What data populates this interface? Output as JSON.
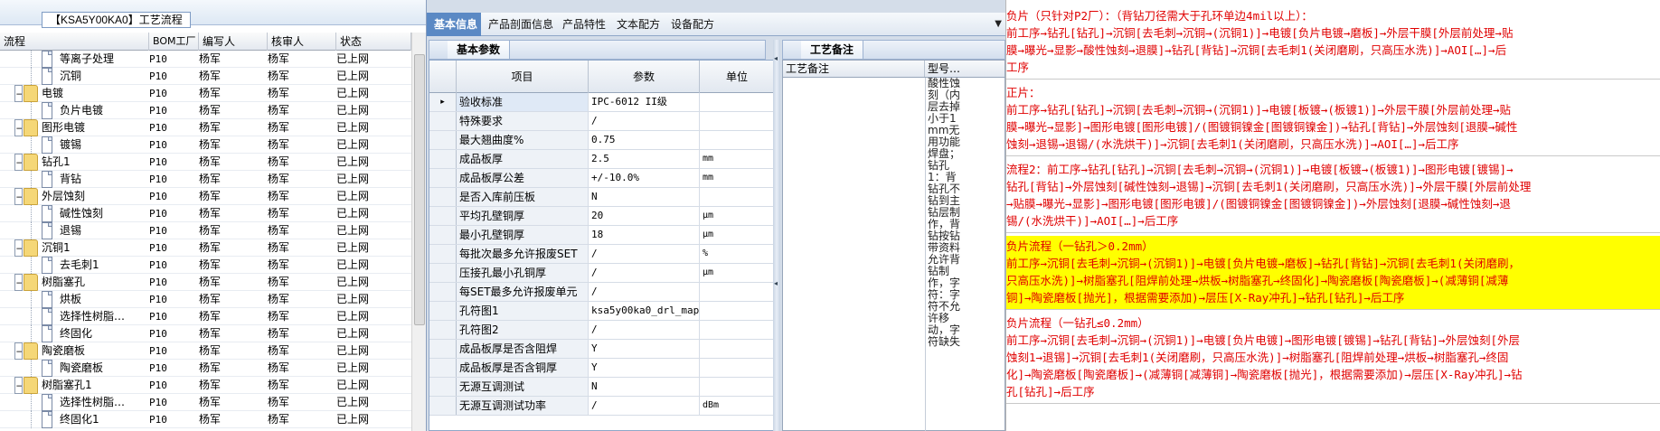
{
  "left_panel": {
    "title": "【KSA5Y00KA0】工艺流程",
    "columns": [
      "流程",
      "BOM工厂",
      "编写人",
      "核审人",
      "状态"
    ],
    "rows": [
      {
        "name": "等离子处理",
        "type": "doc",
        "level": 2,
        "bom": "P10",
        "writer": "杨军",
        "reviewer": "杨军",
        "status": "已上网"
      },
      {
        "name": "沉铜",
        "type": "doc",
        "level": 2,
        "bom": "P10",
        "writer": "杨军",
        "reviewer": "杨军",
        "status": "已上网"
      },
      {
        "name": "电镀",
        "type": "folder",
        "level": 1,
        "bom": "P10",
        "writer": "杨军",
        "reviewer": "杨军",
        "status": "已上网"
      },
      {
        "name": "负片电镀",
        "type": "doc",
        "level": 2,
        "bom": "P10",
        "writer": "杨军",
        "reviewer": "杨军",
        "status": "已上网"
      },
      {
        "name": "图形电镀",
        "type": "folder",
        "level": 1,
        "bom": "P10",
        "writer": "杨军",
        "reviewer": "杨军",
        "status": "已上网"
      },
      {
        "name": "镀锡",
        "type": "doc",
        "level": 2,
        "bom": "P10",
        "writer": "杨军",
        "reviewer": "杨军",
        "status": "已上网"
      },
      {
        "name": "钻孔1",
        "type": "folder",
        "level": 1,
        "bom": "P10",
        "writer": "杨军",
        "reviewer": "杨军",
        "status": "已上网"
      },
      {
        "name": "背钻",
        "type": "doc",
        "level": 2,
        "bom": "P10",
        "writer": "杨军",
        "reviewer": "杨军",
        "status": "已上网"
      },
      {
        "name": "外层蚀刻",
        "type": "folder",
        "level": 1,
        "bom": "P10",
        "writer": "杨军",
        "reviewer": "杨军",
        "status": "已上网"
      },
      {
        "name": "碱性蚀刻",
        "type": "doc",
        "level": 2,
        "bom": "P10",
        "writer": "杨军",
        "reviewer": "杨军",
        "status": "已上网"
      },
      {
        "name": "退锡",
        "type": "doc",
        "level": 2,
        "bom": "P10",
        "writer": "杨军",
        "reviewer": "杨军",
        "status": "已上网"
      },
      {
        "name": "沉铜1",
        "type": "folder",
        "level": 1,
        "bom": "P10",
        "writer": "杨军",
        "reviewer": "杨军",
        "status": "已上网"
      },
      {
        "name": "去毛刺1",
        "type": "doc",
        "level": 2,
        "bom": "P10",
        "writer": "杨军",
        "reviewer": "杨军",
        "status": "已上网"
      },
      {
        "name": "树脂塞孔",
        "type": "folder",
        "level": 1,
        "bom": "P10",
        "writer": "杨军",
        "reviewer": "杨军",
        "status": "已上网"
      },
      {
        "name": "烘板",
        "type": "doc",
        "level": 2,
        "bom": "P10",
        "writer": "杨军",
        "reviewer": "杨军",
        "status": "已上网"
      },
      {
        "name": "选择性树脂…",
        "type": "doc",
        "level": 2,
        "bom": "P10",
        "writer": "杨军",
        "reviewer": "杨军",
        "status": "已上网"
      },
      {
        "name": "终固化",
        "type": "doc",
        "level": 2,
        "bom": "P10",
        "writer": "杨军",
        "reviewer": "杨军",
        "status": "已上网"
      },
      {
        "name": "陶瓷磨板",
        "type": "folder",
        "level": 1,
        "bom": "P10",
        "writer": "杨军",
        "reviewer": "杨军",
        "status": "已上网"
      },
      {
        "name": "陶瓷磨板",
        "type": "doc",
        "level": 2,
        "bom": "P10",
        "writer": "杨军",
        "reviewer": "杨军",
        "status": "已上网"
      },
      {
        "name": "树脂塞孔1",
        "type": "folder",
        "level": 1,
        "bom": "P10",
        "writer": "杨军",
        "reviewer": "杨军",
        "status": "已上网"
      },
      {
        "name": "选择性树脂…",
        "type": "doc",
        "level": 2,
        "bom": "P10",
        "writer": "杨军",
        "reviewer": "杨军",
        "status": "已上网"
      },
      {
        "name": "终固化1",
        "type": "doc",
        "level": 2,
        "bom": "P10",
        "writer": "杨军",
        "reviewer": "杨军",
        "status": "已上网"
      }
    ]
  },
  "middle_panel": {
    "tabs": [
      "基本信息",
      "产品剖面信息",
      "产品特性",
      "文本配方",
      "设备配方"
    ],
    "sub_tab_left": "基本参数",
    "sub_tab_right": "工艺备注",
    "grid_headers": [
      "项目",
      "参数",
      "单位"
    ],
    "grid_rows": [
      {
        "name": "验收标准",
        "param": "IPC-6012 II级",
        "unit": "",
        "selected": true
      },
      {
        "name": "特殊要求",
        "param": "/",
        "unit": ""
      },
      {
        "name": "最大翘曲度%",
        "param": "0.75",
        "unit": ""
      },
      {
        "name": "成品板厚",
        "param": "2.5",
        "unit": "mm"
      },
      {
        "name": "成品板厚公差",
        "param": "+/-10.0%",
        "unit": "mm"
      },
      {
        "name": "是否入库前压板",
        "param": "N",
        "unit": ""
      },
      {
        "name": "平均孔壁铜厚",
        "param": "20",
        "unit": "μm"
      },
      {
        "name": "最小孔壁铜厚",
        "param": "18",
        "unit": "μm"
      },
      {
        "name": "每批次最多允许报废SET",
        "param": "/",
        "unit": "%"
      },
      {
        "name": "压接孔最小孔铜厚",
        "param": "/",
        "unit": "μm"
      },
      {
        "name": "每SET最多允许报废单元",
        "param": "/",
        "unit": ""
      },
      {
        "name": "孔符图1",
        "param": "ksa5y00ka0_drl_map.pdf",
        "unit": ""
      },
      {
        "name": "孔符图2",
        "param": "/",
        "unit": ""
      },
      {
        "name": "成品板厚是否含阻焊",
        "param": "Y",
        "unit": ""
      },
      {
        "name": "成品板厚是否含铜厚",
        "param": "Y",
        "unit": ""
      },
      {
        "name": "无源互调测试",
        "param": "N",
        "unit": ""
      },
      {
        "name": "无源互调测试功率",
        "param": "/",
        "unit": "dBm"
      }
    ],
    "notes_headers": [
      "工艺备注",
      "型号…"
    ],
    "notes_side_text": "酸性蚀刻（内层去掉小于1mm无用功能焊盘；钻孔1：背钻孔不钻到主钻层制作，背钻按钻带资料允许背钻制作，字符：字符不允许移动，字符缺失"
  },
  "right_panel": {
    "blocks": [
      {
        "highlight": false,
        "lines": [
          "负片（只针对P2厂）：（背钻刀径需大于孔环单边4mil以上）：",
          "前工序→钻孔[钻孔]→沉铜[去毛刺→沉铜→(沉铜1)]→电镀[负片电镀→磨板]→外层干膜[外层前处理→贴",
          "膜→曝光→显影→酸性蚀刻→退膜]→钻孔[背钻]→沉铜[去毛刺1(关闭磨刷，只高压水洗)]→AOI[…]→后",
          "工序"
        ]
      },
      {
        "highlight": false,
        "lines": [
          "正片：",
          "前工序→钻孔[钻孔]→沉铜[去毛刺→沉铜→(沉铜1)]→电镀[板镀→(板镀1)]→外层干膜[外层前处理→贴",
          "膜→曝光→显影]→图形电镀[图形电镀]/(图镀铜镍金[图镀铜镍金])→钻孔[背钻]→外层蚀刻[退膜→碱性",
          "蚀刻→退锡→退锡/(水洗烘干)]→沉铜[去毛刺1(关闭磨刷，只高压水洗)]→AOI[…]→后工序"
        ]
      },
      {
        "highlight": false,
        "lines": [
          "流程2：前工序→钻孔[钻孔]→沉铜[去毛刺→沉铜→(沉铜1)]→电镀[板镀→(板镀1)]→图形电镀[镀锡]→",
          "钻孔[背钻]→外层蚀刻[碱性蚀刻→退锡]→沉铜[去毛刺1(关闭磨刷，只高压水洗)]→外层干膜[外层前处理",
          "→贴膜→曝光→显影]→图形电镀[图形电镀]/(图镀铜镍金[图镀铜镍金])→外层蚀刻[退膜→碱性蚀刻→退",
          "锡/(水洗烘干)]→AOI[…]→后工序"
        ]
      },
      {
        "highlight": true,
        "lines": [
          "负片流程（一钻孔＞0.2mm）",
          "前工序→沉铜[去毛刺→沉铜→(沉铜1)]→电镀[负片电镀→磨板]→钻孔[背钻]→沉铜[去毛刺1(关闭磨刷，",
          "只高压水洗)]→树脂塞孔[阻焊前处理→烘板→树脂塞孔→终固化]→陶瓷磨板[陶瓷磨板]→(减薄铜[减薄",
          "铜]→陶瓷磨板[抛光]，根据需要添加)→层压[X-Ray冲孔]→钻孔[钻孔]→后工序"
        ]
      },
      {
        "highlight": false,
        "lines": [
          "负片流程（一钻孔≤0.2mm）",
          "前工序→沉铜[去毛刺→沉铜→(沉铜1)]→电镀[负片电镀]→图形电镀[镀锡]→钻孔[背钻]→外层蚀刻[外层",
          "蚀刻1→退锡]→沉铜[去毛刺1(关闭磨刷，只高压水洗)]→树脂塞孔[阻焊前处理→烘板→树脂塞孔→终固",
          "化]→陶瓷磨板[陶瓷磨板]→(减薄铜[减薄铜]→陶瓷磨板[抛光]，根据需要添加)→层压[X-Ray冲孔]→钻",
          "孔[钻孔]→后工序"
        ]
      }
    ]
  },
  "colors": {
    "accent_tab": "#5b89c4",
    "red_text": "#e00000",
    "highlight": "#ffff00",
    "folder": "#f5d777"
  },
  "icons": [
    "folder-icon",
    "document-icon",
    "expand-icon",
    "chevron-down-icon",
    "splitter-arrow-icon"
  ]
}
